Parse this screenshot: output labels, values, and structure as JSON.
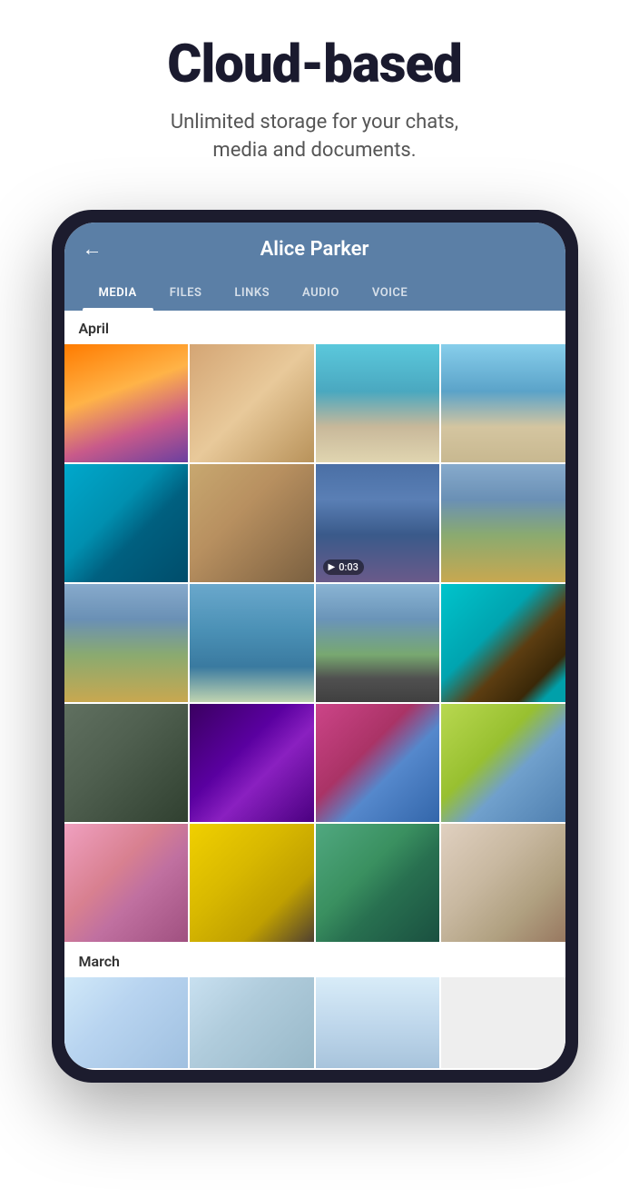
{
  "hero": {
    "title": "Cloud-based",
    "subtitle": "Unlimited storage for your chats,\nmedia and documents."
  },
  "phone": {
    "contact_name": "Alice Parker",
    "back_label": "←",
    "tabs": [
      {
        "label": "MEDIA",
        "active": true
      },
      {
        "label": "FILES",
        "active": false
      },
      {
        "label": "LINKS",
        "active": false
      },
      {
        "label": "AUDIO",
        "active": false
      },
      {
        "label": "VOICE",
        "active": false
      }
    ],
    "months": [
      {
        "name": "April",
        "rows": [
          [
            "img-sunset",
            "img-drinks",
            "img-beach",
            "img-lifeguard"
          ],
          [
            "img-surf",
            "img-woodcarving",
            "img-friends",
            "img-lake-fall"
          ],
          [
            "img-lake-fall",
            "img-lake-calm",
            "img-road",
            "img-turtle"
          ],
          [
            "img-car-vintage",
            "img-concert",
            "img-car-street",
            "img-smoke"
          ],
          [
            "img-woman",
            "img-yellow-car",
            "img-lion",
            "img-cat"
          ]
        ],
        "video_cell": {
          "row": 1,
          "col": 3,
          "duration": "0:03"
        }
      },
      {
        "name": "March",
        "rows": [
          [
            "img-snow1",
            "img-snow2",
            "img-snow3"
          ]
        ]
      }
    ]
  }
}
